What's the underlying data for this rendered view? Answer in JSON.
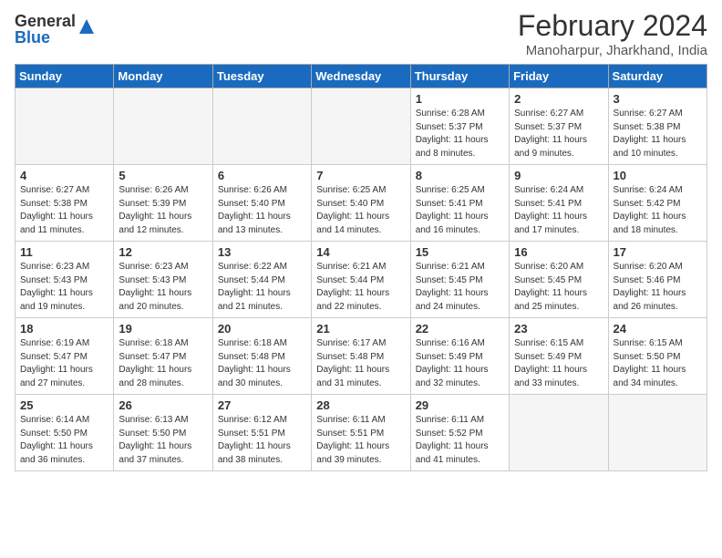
{
  "header": {
    "logo_general": "General",
    "logo_blue": "Blue",
    "main_title": "February 2024",
    "sub_title": "Manoharpur, Jharkhand, India"
  },
  "days_of_week": [
    "Sunday",
    "Monday",
    "Tuesday",
    "Wednesday",
    "Thursday",
    "Friday",
    "Saturday"
  ],
  "weeks": [
    [
      {
        "day": "",
        "info": ""
      },
      {
        "day": "",
        "info": ""
      },
      {
        "day": "",
        "info": ""
      },
      {
        "day": "",
        "info": ""
      },
      {
        "day": "1",
        "info": "Sunrise: 6:28 AM\nSunset: 5:37 PM\nDaylight: 11 hours and 8 minutes."
      },
      {
        "day": "2",
        "info": "Sunrise: 6:27 AM\nSunset: 5:37 PM\nDaylight: 11 hours and 9 minutes."
      },
      {
        "day": "3",
        "info": "Sunrise: 6:27 AM\nSunset: 5:38 PM\nDaylight: 11 hours and 10 minutes."
      }
    ],
    [
      {
        "day": "4",
        "info": "Sunrise: 6:27 AM\nSunset: 5:38 PM\nDaylight: 11 hours and 11 minutes."
      },
      {
        "day": "5",
        "info": "Sunrise: 6:26 AM\nSunset: 5:39 PM\nDaylight: 11 hours and 12 minutes."
      },
      {
        "day": "6",
        "info": "Sunrise: 6:26 AM\nSunset: 5:40 PM\nDaylight: 11 hours and 13 minutes."
      },
      {
        "day": "7",
        "info": "Sunrise: 6:25 AM\nSunset: 5:40 PM\nDaylight: 11 hours and 14 minutes."
      },
      {
        "day": "8",
        "info": "Sunrise: 6:25 AM\nSunset: 5:41 PM\nDaylight: 11 hours and 16 minutes."
      },
      {
        "day": "9",
        "info": "Sunrise: 6:24 AM\nSunset: 5:41 PM\nDaylight: 11 hours and 17 minutes."
      },
      {
        "day": "10",
        "info": "Sunrise: 6:24 AM\nSunset: 5:42 PM\nDaylight: 11 hours and 18 minutes."
      }
    ],
    [
      {
        "day": "11",
        "info": "Sunrise: 6:23 AM\nSunset: 5:43 PM\nDaylight: 11 hours and 19 minutes."
      },
      {
        "day": "12",
        "info": "Sunrise: 6:23 AM\nSunset: 5:43 PM\nDaylight: 11 hours and 20 minutes."
      },
      {
        "day": "13",
        "info": "Sunrise: 6:22 AM\nSunset: 5:44 PM\nDaylight: 11 hours and 21 minutes."
      },
      {
        "day": "14",
        "info": "Sunrise: 6:21 AM\nSunset: 5:44 PM\nDaylight: 11 hours and 22 minutes."
      },
      {
        "day": "15",
        "info": "Sunrise: 6:21 AM\nSunset: 5:45 PM\nDaylight: 11 hours and 24 minutes."
      },
      {
        "day": "16",
        "info": "Sunrise: 6:20 AM\nSunset: 5:45 PM\nDaylight: 11 hours and 25 minutes."
      },
      {
        "day": "17",
        "info": "Sunrise: 6:20 AM\nSunset: 5:46 PM\nDaylight: 11 hours and 26 minutes."
      }
    ],
    [
      {
        "day": "18",
        "info": "Sunrise: 6:19 AM\nSunset: 5:47 PM\nDaylight: 11 hours and 27 minutes."
      },
      {
        "day": "19",
        "info": "Sunrise: 6:18 AM\nSunset: 5:47 PM\nDaylight: 11 hours and 28 minutes."
      },
      {
        "day": "20",
        "info": "Sunrise: 6:18 AM\nSunset: 5:48 PM\nDaylight: 11 hours and 30 minutes."
      },
      {
        "day": "21",
        "info": "Sunrise: 6:17 AM\nSunset: 5:48 PM\nDaylight: 11 hours and 31 minutes."
      },
      {
        "day": "22",
        "info": "Sunrise: 6:16 AM\nSunset: 5:49 PM\nDaylight: 11 hours and 32 minutes."
      },
      {
        "day": "23",
        "info": "Sunrise: 6:15 AM\nSunset: 5:49 PM\nDaylight: 11 hours and 33 minutes."
      },
      {
        "day": "24",
        "info": "Sunrise: 6:15 AM\nSunset: 5:50 PM\nDaylight: 11 hours and 34 minutes."
      }
    ],
    [
      {
        "day": "25",
        "info": "Sunrise: 6:14 AM\nSunset: 5:50 PM\nDaylight: 11 hours and 36 minutes."
      },
      {
        "day": "26",
        "info": "Sunrise: 6:13 AM\nSunset: 5:50 PM\nDaylight: 11 hours and 37 minutes."
      },
      {
        "day": "27",
        "info": "Sunrise: 6:12 AM\nSunset: 5:51 PM\nDaylight: 11 hours and 38 minutes."
      },
      {
        "day": "28",
        "info": "Sunrise: 6:11 AM\nSunset: 5:51 PM\nDaylight: 11 hours and 39 minutes."
      },
      {
        "day": "29",
        "info": "Sunrise: 6:11 AM\nSunset: 5:52 PM\nDaylight: 11 hours and 41 minutes."
      },
      {
        "day": "",
        "info": ""
      },
      {
        "day": "",
        "info": ""
      }
    ]
  ]
}
